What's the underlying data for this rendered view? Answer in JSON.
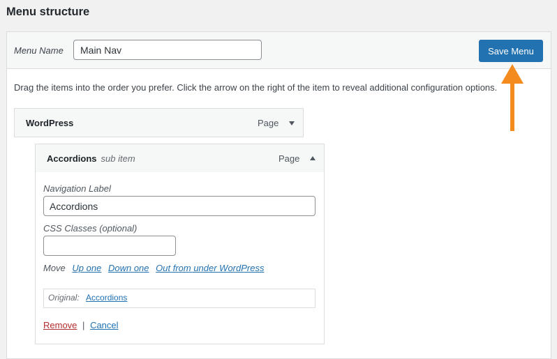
{
  "page": {
    "heading": "Menu structure"
  },
  "header": {
    "menu_name_label": "Menu Name",
    "menu_name_value": "Main Nav",
    "save_label": "Save Menu"
  },
  "instructions": "Drag the items into the order you prefer. Click the arrow on the right of the item to reveal additional configuration options.",
  "items": [
    {
      "title": "WordPress",
      "subtitle": "",
      "type": "Page",
      "expanded": false
    },
    {
      "title": "Accordions",
      "subtitle": "sub item",
      "type": "Page",
      "expanded": true,
      "settings": {
        "nav_label_label": "Navigation Label",
        "nav_label_value": "Accordions",
        "css_label": "CSS Classes (optional)",
        "css_value": "",
        "move_label": "Move",
        "move_links": [
          "Up one",
          "Down one",
          "Out from under WordPress"
        ],
        "original_label": "Original:",
        "original_link": "Accordions",
        "remove_label": "Remove",
        "separator": "|",
        "cancel_label": "Cancel"
      }
    }
  ],
  "colors": {
    "accent": "#2271b1",
    "annotation": "#f38b1e",
    "remove": "#b32d2e"
  },
  "icons": {
    "collapsed": "triangle-down-icon",
    "expanded": "triangle-up-icon",
    "annotation": "arrow-up-annotation"
  }
}
